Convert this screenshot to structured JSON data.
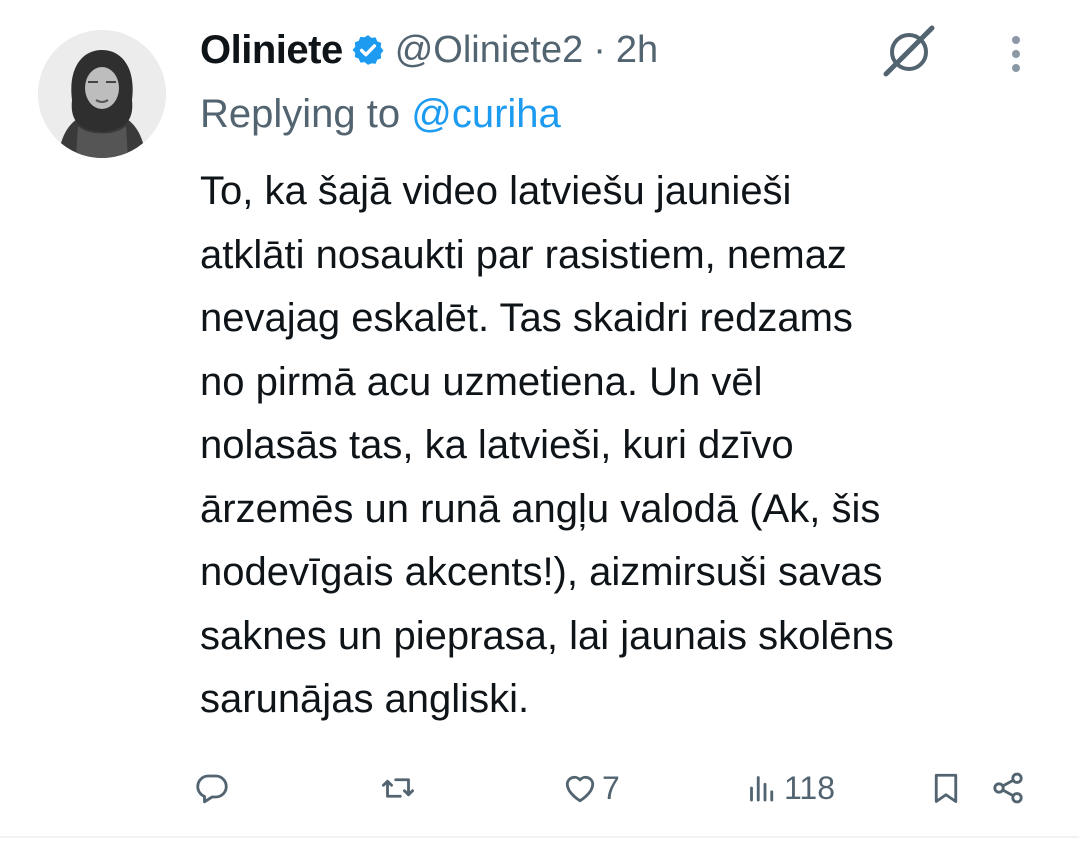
{
  "tweet": {
    "author_name": "Oliniete",
    "author_handle": "@Oliniete2",
    "separator": "·",
    "time": "2h",
    "replying_prefix": "Replying to",
    "replying_to": "@curiha",
    "text_lines": [
      "To, ka šajā video latviešu jaunieši",
      "atklāti nosaukti par rasistiem, nemaz",
      "nevajag eskalēt. Tas skaidri redzams",
      "no pirmā acu uzmetiena. Un vēl",
      "nolasās tas, ka latvieši, kuri dzīvo",
      "ārzemēs un runā angļu valodā (Ak, šis",
      "nodevīgais akcents!), aizmirsuši savas",
      "saknes un pieprasa, lai jaunais skolēns",
      "sarunājas angliski."
    ],
    "verified_icon": "verified-badge-icon",
    "accent_color": "#1d9bf0"
  },
  "actions": {
    "reply_icon": "reply-icon",
    "retweet_icon": "retweet-icon",
    "like_icon": "heart-icon",
    "like_count": "7",
    "views_icon": "views-icon",
    "views_count": "118",
    "bookmark_icon": "bookmark-icon",
    "share_icon": "share-icon"
  }
}
